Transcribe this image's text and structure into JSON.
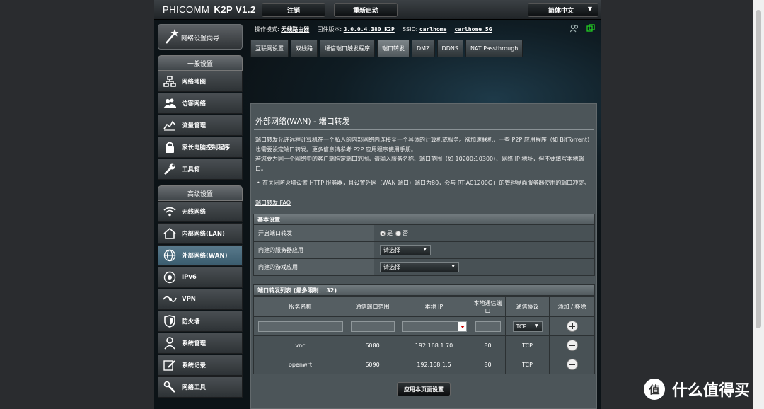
{
  "header": {
    "brand": "PHICOMM",
    "model": "K2P V1.2",
    "logout_label": "注销",
    "reboot_label": "重新启动",
    "language": "简体中文"
  },
  "sidebar": {
    "wizard_label": "网络设置向导",
    "general_header": "一般设置",
    "general_items": [
      "网络地图",
      "访客网络",
      "流量管理",
      "家长电脑控制程序",
      "工具箱"
    ],
    "advanced_header": "高级设置",
    "advanced_items": [
      "无线网络",
      "内部网络(LAN)",
      "外部网络(WAN)",
      "IPv6",
      "VPN",
      "防火墙",
      "系统管理",
      "系统记录",
      "网络工具"
    ],
    "active_item": "外部网络(WAN)"
  },
  "infobar": {
    "mode_label": "操作模式:",
    "mode_value": "无线路由器",
    "firmware_label": "固件版本:",
    "firmware_value": "3.0.0.4.380_K2P",
    "ssid_label": "SSID:",
    "ssid_values": [
      "carlhome",
      "carlhome_5G"
    ]
  },
  "tabs": [
    "互联网设置",
    "双线路",
    "通信端口触发程序",
    "端口转发",
    "DMZ",
    "DDNS",
    "NAT Passthrough"
  ],
  "active_tab": "端口转发",
  "panel": {
    "title": "外部网络(WAN) - 端口转发",
    "desc1": "端口转发允许远程计算机在一个私人的内部网络内连接至一个具体的计算机或服务。欲加速联机，一些 P2P 应用程序（如 BitTorrent）也需要设定端口转发。更多信息请参考 P2P 应用程序使用手册。",
    "desc2": "若您要为同一个网络中的客户端指定端口范围，请输入服务名称、端口范围（如 10200:10300）、网络 IP 地址，但不要填写本地端口。",
    "bullet": "在关闭防火墙设置 HTTP 服务器，且设置外网（WAN 端口）端口为80，会与 RT-AC1200G+ 的管理界面服务器使用的端口冲突。",
    "faq_label": "端口转发 FAQ"
  },
  "basic": {
    "header": "基本设置",
    "enable_label": "开启端口转发",
    "yes": "是",
    "no": "否",
    "server_label": "内建的服务器应用",
    "server_value": "请选择",
    "game_label": "内建的游戏应用",
    "game_value": "请选择"
  },
  "table": {
    "header": "端口转发列表 (最多限制： 32)",
    "columns": [
      "服务名称",
      "通信端口范围",
      "本地 IP",
      "本地通信端口",
      "通信协议",
      "添加 / 移除"
    ],
    "new_protocol": "TCP",
    "rows": [
      {
        "name": "vnc",
        "range": "6080",
        "ip": "192.168.1.70",
        "port": "80",
        "proto": "TCP"
      },
      {
        "name": "openwrt",
        "range": "6090",
        "ip": "192.168.1.5",
        "port": "80",
        "proto": "TCP"
      }
    ]
  },
  "apply_label": "应用本页面设置",
  "watermark": {
    "badge": "值",
    "text": "什么值得买"
  }
}
